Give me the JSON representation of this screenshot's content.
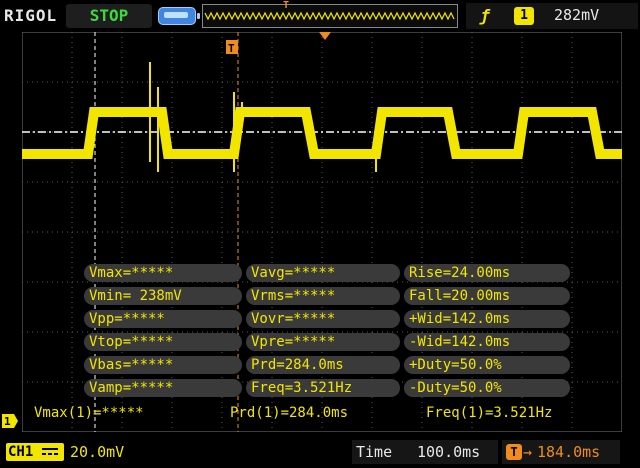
{
  "header": {
    "brand": "RIGOL",
    "run_state": "STOP",
    "memory_icon": "memory-depth-icon",
    "trigger_position_marker": "T",
    "trigger": {
      "edge_icon": "rising-edge-icon",
      "source": "1",
      "level": "282mV"
    }
  },
  "screen": {
    "trigger_marker": "T",
    "channel_marker": "1"
  },
  "measurements": {
    "rows": [
      [
        "Vmax=*****",
        "Vavg=*****",
        "Rise=24.00ms"
      ],
      [
        "Vmin= 238mV",
        "Vrms=*****",
        "Fall=20.00ms"
      ],
      [
        "Vpp=*****",
        "Vovr=*****",
        "+Wid=142.0ms"
      ],
      [
        "Vtop=*****",
        "Vpre=*****",
        "-Wid=142.0ms"
      ],
      [
        "Vbas=*****",
        "Prd=284.0ms",
        "+Duty=50.0%"
      ],
      [
        "Vamp=*****",
        "Freq=3.521Hz",
        "-Duty=50.0%"
      ]
    ]
  },
  "status_line": {
    "vmax": "Vmax(1)=*****",
    "prd": "Prd(1)=284.0ms",
    "freq": "Freq(1)=3.521Hz"
  },
  "footer": {
    "channel": "CH1",
    "coupling_icon": "dc-coupling-icon",
    "vertical_scale": "20.0mV",
    "time_label": "Time",
    "time_scale": "100.0ms",
    "offset_icon": "T",
    "offset_arrow": "→",
    "trigger_offset": "184.0ms"
  },
  "colors": {
    "channel1": "#f2e600",
    "trigger": "#f08c1e",
    "grid": "#5a5a5a",
    "background": "#000000",
    "stop": "#3cdc3c"
  }
}
